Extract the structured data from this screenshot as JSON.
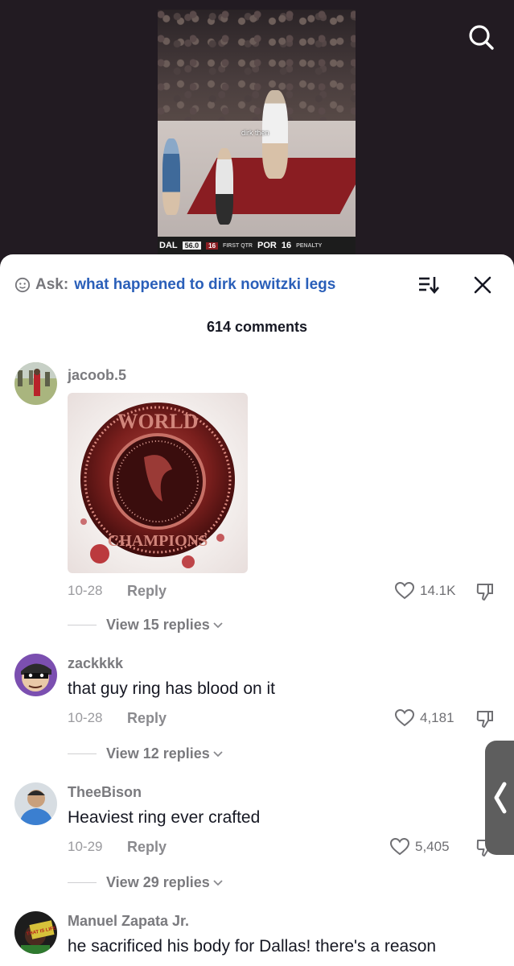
{
  "video": {
    "caption": "dirk then",
    "score": {
      "team_home": "DAL",
      "time": "56.0",
      "period": "16",
      "period_label": "FIRST QTR",
      "team_away": "POR",
      "away_score": "16",
      "sub_label": "PENALTY"
    }
  },
  "header": {
    "ask_label": "Ask:",
    "ask_query": "what happened to dirk nowitzki legs",
    "comment_count": "614 comments"
  },
  "comments": [
    {
      "username": "jacoob.5",
      "text": "",
      "image_text": [
        "WORLD",
        "CHAMPIONS"
      ],
      "date": "10-28",
      "reply_label": "Reply",
      "likes": "14.1K",
      "view_replies": "View 15 replies"
    },
    {
      "username": "zackkkk",
      "text": "that guy ring has blood on it",
      "date": "10-28",
      "reply_label": "Reply",
      "likes": "4,181",
      "view_replies": "View 12 replies"
    },
    {
      "username": "TheeBison",
      "text": "Heaviest ring ever crafted",
      "date": "10-29",
      "reply_label": "Reply",
      "likes": "5,405",
      "view_replies": "View 29 replies"
    },
    {
      "username": "Manuel Zapata Jr.",
      "text": "he sacrificed his body for Dallas! there's a reason",
      "avatar_text": "THAT IS LIFE"
    }
  ],
  "colors": {
    "accent_blue": "#2a5fb9",
    "ring_red": "#8a1d22"
  },
  "icons": [
    "search-icon",
    "ask-face-icon",
    "sort-icon",
    "close-icon",
    "heart-icon",
    "dislike-icon",
    "chevron-down-icon",
    "chevron-left-icon"
  ]
}
